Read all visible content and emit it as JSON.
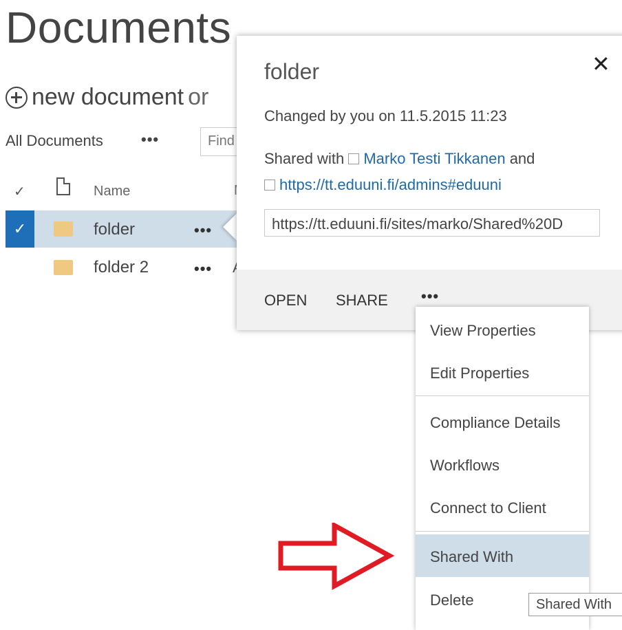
{
  "page": {
    "title": "Documents",
    "new_document_text": "new document",
    "new_document_suffix": "or",
    "view_name": "All Documents",
    "view_more": "•••",
    "search_placeholder": "Find"
  },
  "table": {
    "headers": {
      "name": "Name",
      "modified_partial": "M"
    },
    "rows": [
      {
        "name": "folder",
        "selected": true,
        "more": "•••"
      },
      {
        "name": "folder 2",
        "selected": false,
        "more": "•••",
        "partial_next": "A"
      }
    ]
  },
  "callout": {
    "title": "folder",
    "changed": "Changed by you on 11.5.2015 11:23",
    "shared_prefix": "Shared with",
    "shared_user": "Marko Testi Tikkanen",
    "shared_and": "and",
    "shared_group": "https://tt.eduuni.fi/admins#eduuni",
    "url_value": "https://tt.eduuni.fi/sites/marko/Shared%20D",
    "footer": {
      "open": "OPEN",
      "share": "SHARE",
      "more": "•••"
    }
  },
  "menu": {
    "items": [
      {
        "label": "View Properties"
      },
      {
        "label": "Edit Properties"
      },
      {
        "label": "Compliance Details"
      },
      {
        "label": "Workflows"
      },
      {
        "label": "Connect to Client"
      },
      {
        "label": "Shared With"
      },
      {
        "label": "Delete"
      }
    ]
  },
  "tooltip": "Shared With",
  "colors": {
    "selection": "#cfdde9",
    "checkbox_selected": "#1f6fb8",
    "link": "#1f6aa6",
    "folder": "#efc882",
    "annotation_arrow": "#e01b24"
  }
}
